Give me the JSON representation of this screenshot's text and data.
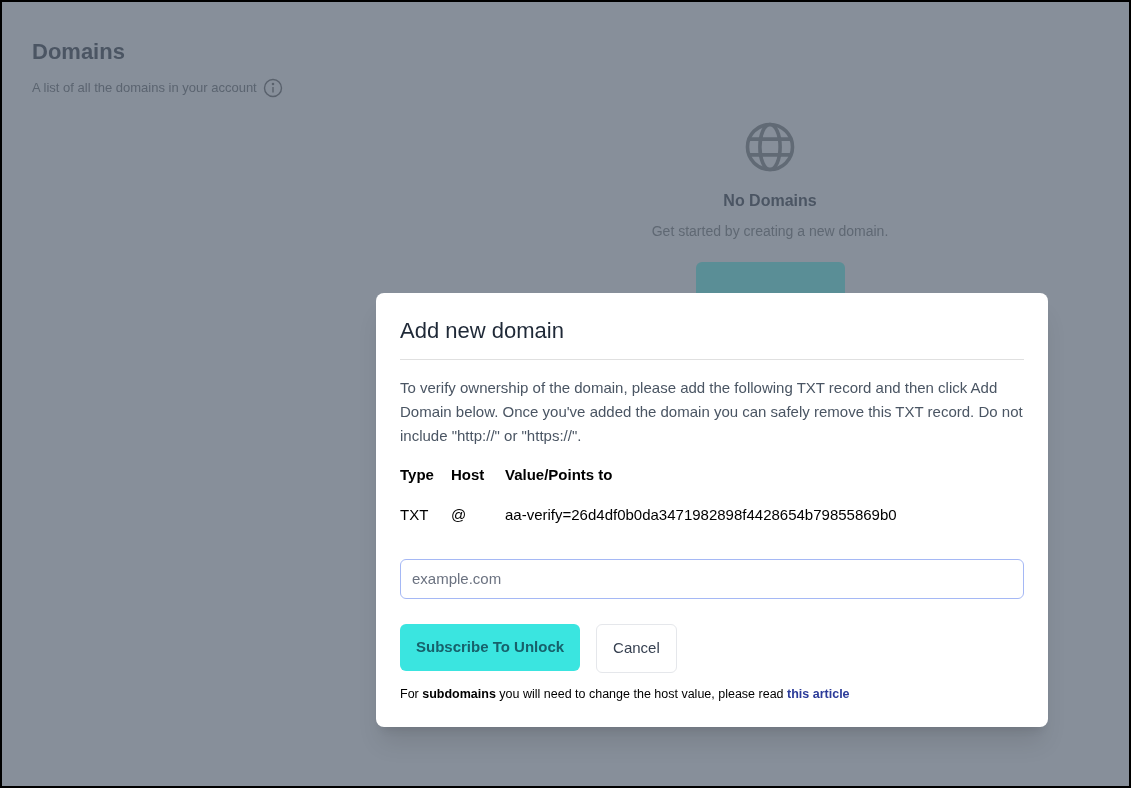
{
  "page": {
    "title": "Domains",
    "subtitle": "A list of all the domains in your account"
  },
  "empty_state": {
    "title": "No Domains",
    "message": "Get started by creating a new domain."
  },
  "modal": {
    "title": "Add new domain",
    "description": "To verify ownership of the domain, please add the following TXT record and then click Add Domain below. Once you've added the domain you can safely remove this TXT record. Do not include \"http://\" or \"https://\".",
    "record_table": {
      "columns": [
        "Type",
        "Host",
        "Value/Points to"
      ],
      "rows": [
        [
          "TXT",
          "@",
          "aa-verify=26d4df0b0da3471982898f4428654b79855869b0"
        ]
      ]
    },
    "domain_field": {
      "placeholder": "example.com"
    },
    "buttons": [
      {
        "label": "Subscribe To Unlock",
        "kind": "primary"
      },
      {
        "label": "Cancel",
        "kind": "secondary"
      }
    ],
    "footnote": {
      "text": "For **subdomains** you will need to change the host value, please read",
      "link": "this article"
    }
  }
}
